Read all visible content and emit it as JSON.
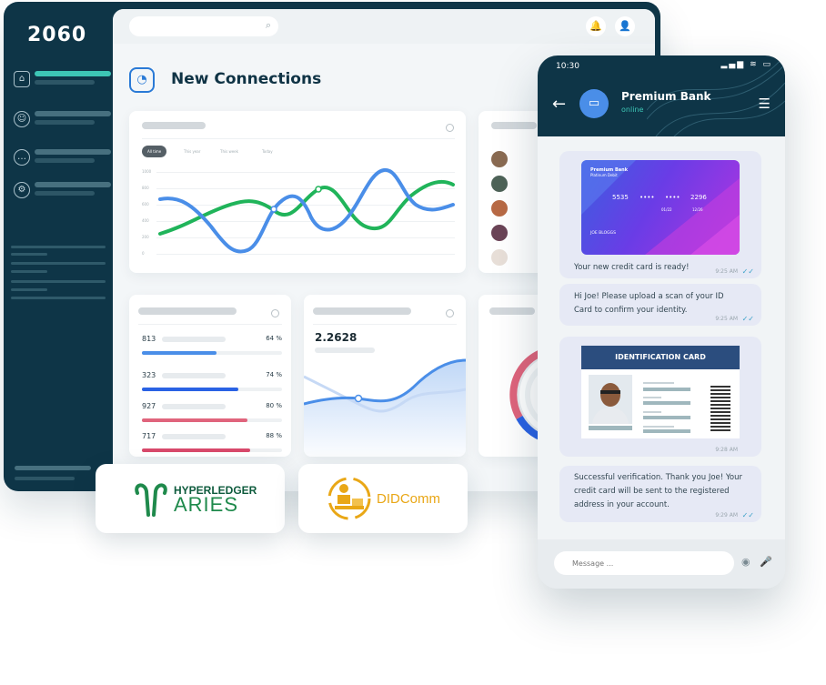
{
  "dashboard": {
    "logo": "2060",
    "page_title": "New Connections",
    "sidebar": {
      "items": [
        {
          "icon": "home-icon",
          "glyph": "⌂"
        },
        {
          "icon": "users-icon",
          "glyph": "☺"
        },
        {
          "icon": "chat-icon",
          "glyph": "…"
        },
        {
          "icon": "settings-icon",
          "glyph": "⚙"
        }
      ]
    },
    "topbar": {
      "bell_glyph": "🔔",
      "user_glyph": "👤",
      "search_glyph": "⌕"
    },
    "filters": [
      "All time",
      "This year",
      "This week",
      "Today"
    ],
    "y_ticks": [
      "1000",
      "800",
      "600",
      "400",
      "200",
      "0"
    ],
    "stats": [
      {
        "value": "813",
        "percent": "64 %",
        "fill": 0.53,
        "color": "#4a8ee8"
      },
      {
        "value": "323",
        "percent": "74 %",
        "fill": 0.69,
        "color": "#2a62e4"
      },
      {
        "value": "927",
        "percent": "80 %",
        "fill": 0.75,
        "color": "#e0647c"
      },
      {
        "value": "717",
        "percent": "88 %",
        "fill": 0.77,
        "color": "#d8496b"
      }
    ],
    "metric_value": "2.2628"
  },
  "badges": {
    "aries_top": "HYPERLEDGER",
    "aries_bottom": "ARIES",
    "didcomm": "DIDComm"
  },
  "phone": {
    "time": "10:30",
    "status_icons": "▂▄▆ ≋ ▭",
    "back_glyph": "←",
    "menu_glyph": "☰",
    "avatar_glyph": "▭",
    "contact_name": "Premium Bank",
    "contact_status": "online",
    "credit_card": {
      "bank": "Premium Bank",
      "tier": "Platinum Debit",
      "num1": "5535",
      "num2": "••••",
      "num3": "••••",
      "num4": "2296",
      "exp1": "01/22",
      "exp2": "12/26",
      "holder": "JOE BLOGGS"
    },
    "messages": [
      {
        "text": "Your new credit card is ready!",
        "time": "9:25 AM"
      },
      {
        "text": "Hi Joe! Please upload a scan of your ID Card to confirm your identity.",
        "time": "9:25 AM"
      },
      {
        "text": "",
        "time": "9:28 AM"
      },
      {
        "text": "Successful verification. Thank you Joe! Your credit card will be sent to the registered address in your account.",
        "time": "9:29 AM"
      }
    ],
    "id_card_title": "IDENTIFICATION CARD",
    "read_tick": "✓✓",
    "composer_placeholder": "Message ...",
    "camera_glyph": "◉",
    "mic_glyph": "🎤"
  }
}
